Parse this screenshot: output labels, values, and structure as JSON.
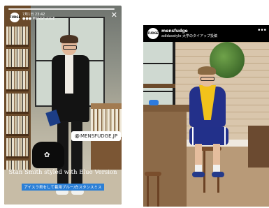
{
  "story": {
    "avatar_text": "FUDGE",
    "meta_line1": "7月1日  23:42",
    "meta_line2": "●●●  MENSFUDGE",
    "close_glyph": "✕",
    "mention": "MENSFUDGE.JP",
    "mention_prefix": "@",
    "caption_main": "Stan Smith styled with Blue Version",
    "caption_sub": "アイスラ男をして着用ブルー/白スタンスミス"
  },
  "post": {
    "avatar_text": "FUDGE",
    "handle": "mensfudge",
    "subline": "adidasstyle 大学のタイアップ投稿",
    "more_glyph": "•••"
  },
  "colors": {
    "accent_blue": "#2b7fd6",
    "adidas_navy": "#23308a",
    "scarf_yellow": "#f2c21b"
  }
}
